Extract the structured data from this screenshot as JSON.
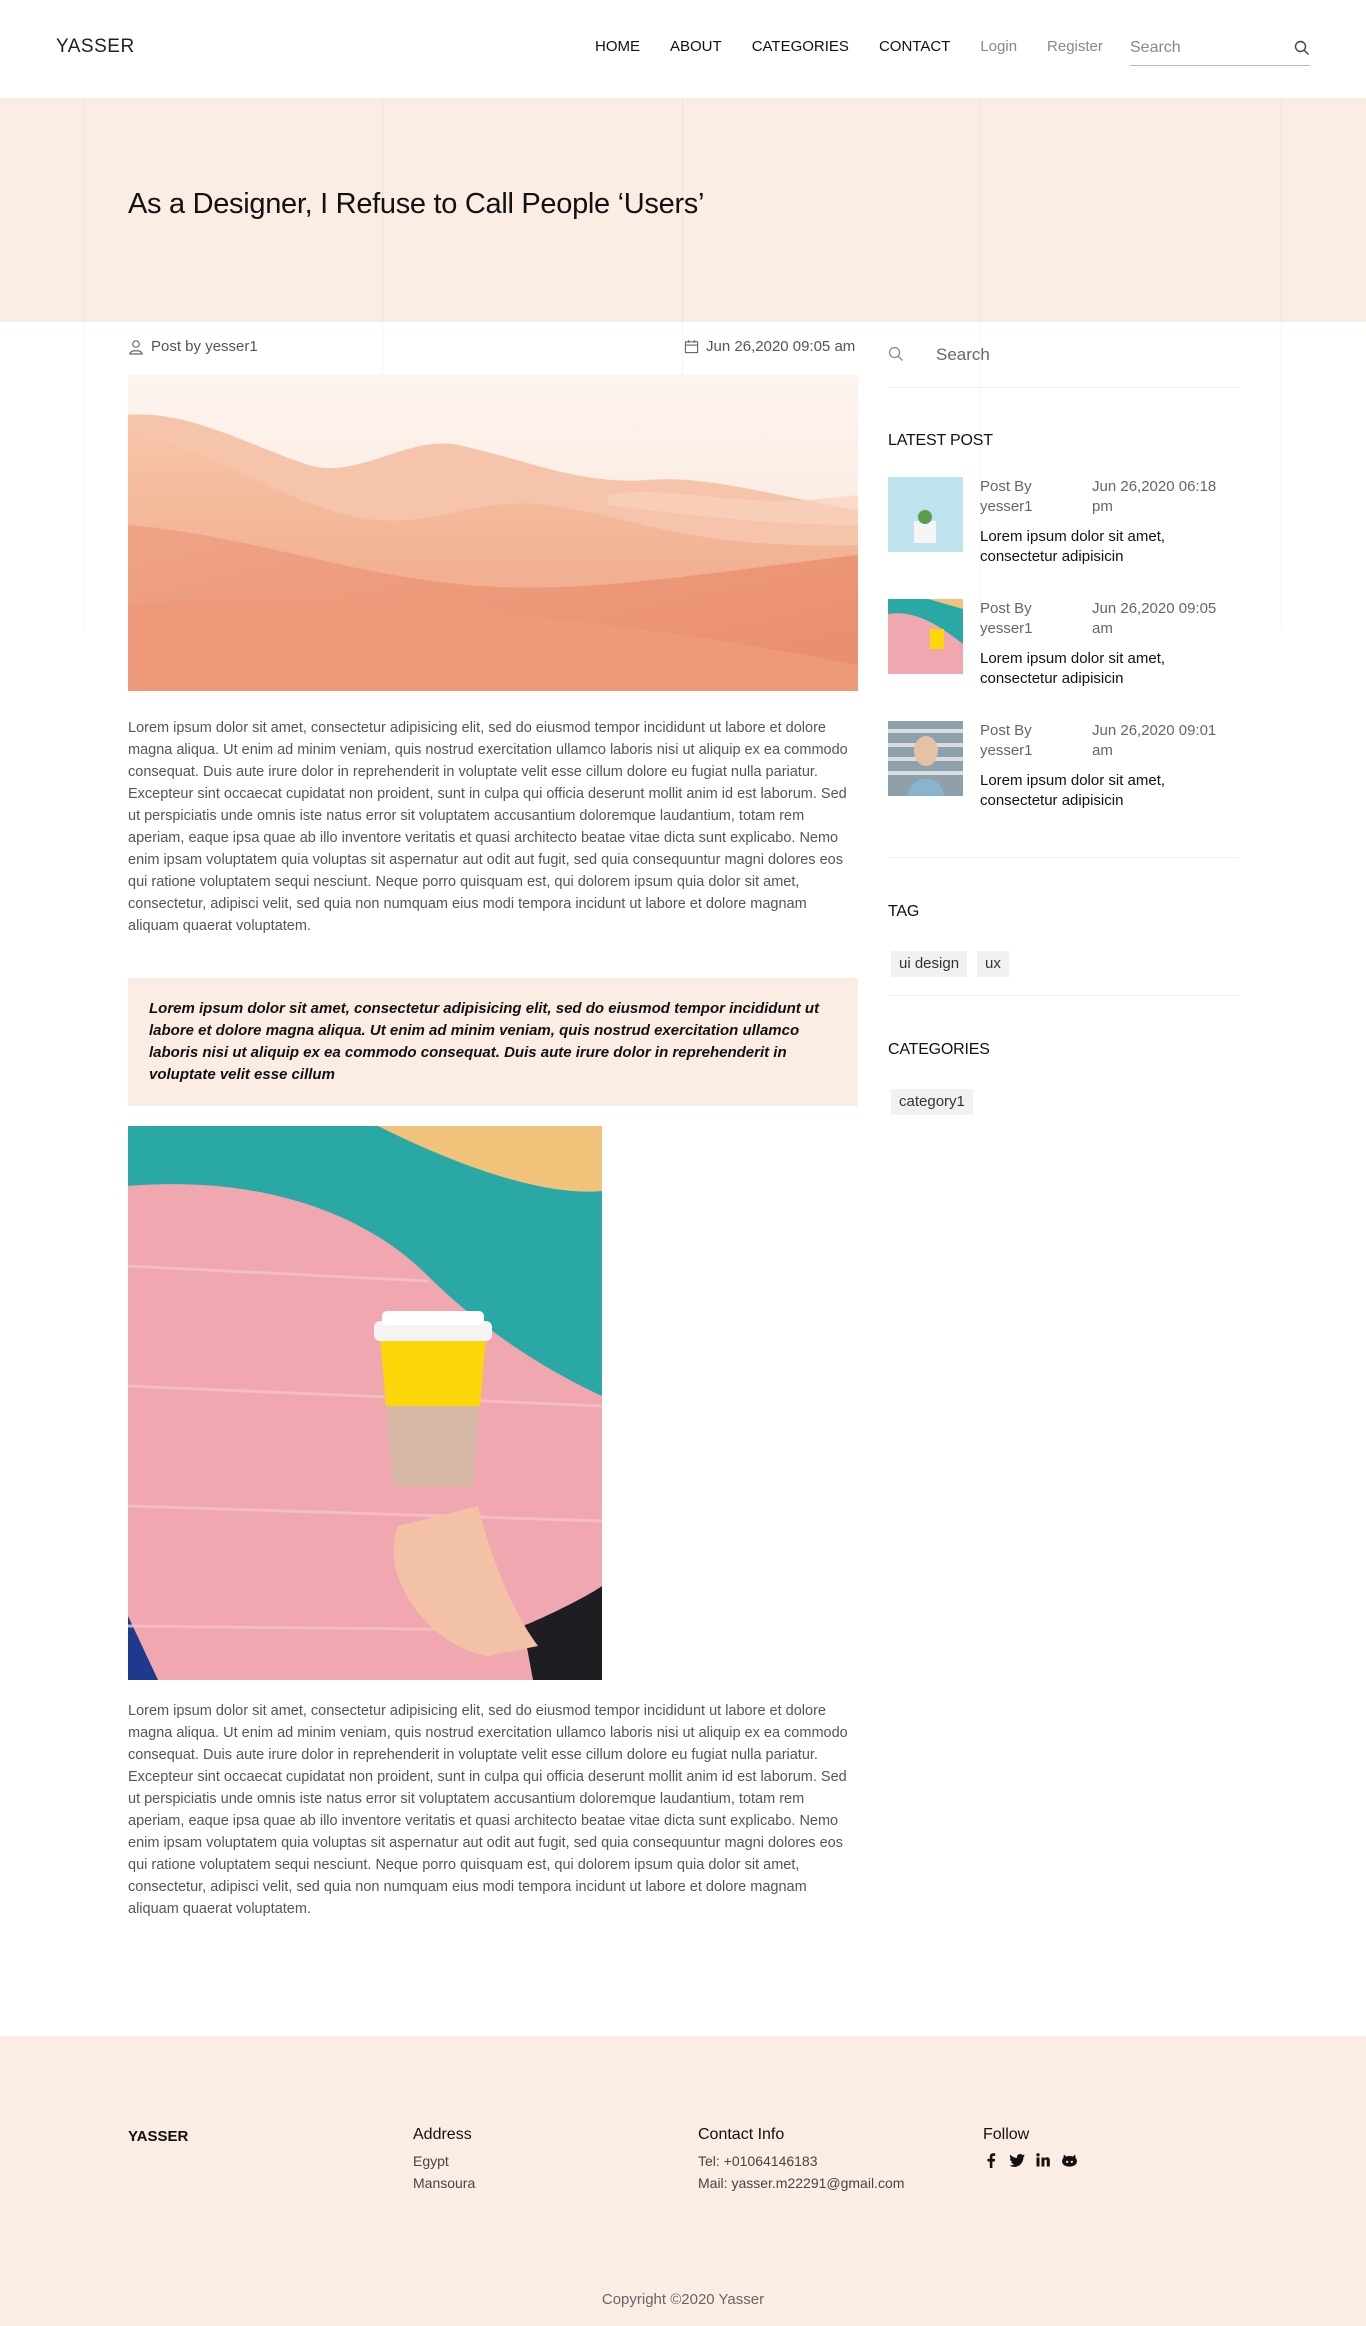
{
  "header": {
    "logo": "YASSER",
    "nav": [
      "HOME",
      "ABOUT",
      "CATEGORIES",
      "CONTACT"
    ],
    "login": "Login",
    "register": "Register",
    "search_placeholder": "Search"
  },
  "hero": {
    "title": "As a Designer, I Refuse to Call People ‘Users’"
  },
  "post": {
    "author": "Post by yesser1",
    "date": "Jun 26,2020 09:05 am",
    "paragraph_1": "Lorem ipsum dolor sit amet, consectetur adipisicing elit, sed do eiusmod tempor incididunt ut labore et dolore magna aliqua. Ut enim ad minim veniam, quis nostrud exercitation ullamco laboris nisi ut aliquip ex ea commodo consequat. Duis aute irure dolor in reprehenderit in voluptate velit esse cillum dolore eu fugiat nulla pariatur. Excepteur sint occaecat cupidatat non proident, sunt in culpa qui officia deserunt mollit anim id est laborum. Sed ut perspiciatis unde omnis iste natus error sit voluptatem accusantium doloremque laudantium, totam rem aperiam, eaque ipsa quae ab illo inventore veritatis et quasi architecto beatae vitae dicta sunt explicabo. Nemo enim ipsam voluptatem quia voluptas sit aspernatur aut odit aut fugit, sed quia consequuntur magni dolores eos qui ratione voluptatem sequi nesciunt. Neque porro quisquam est, qui dolorem ipsum quia dolor sit amet, consectetur, adipisci velit, sed quia non numquam eius modi tempora incidunt ut labore et dolore magnam aliquam quaerat voluptatem.",
    "quote": "Lorem ipsum dolor sit amet, consectetur adipisicing elit, sed do eiusmod tempor incididunt ut labore et dolore magna aliqua. Ut enim ad minim veniam, quis nostrud exercitation ullamco laboris nisi ut aliquip ex ea commodo consequat. Duis aute irure dolor in reprehenderit in voluptate velit esse cillum",
    "paragraph_2": "Lorem ipsum dolor sit amet, consectetur adipisicing elit, sed do eiusmod tempor incididunt ut labore et dolore magna aliqua. Ut enim ad minim veniam, quis nostrud exercitation ullamco laboris nisi ut aliquip ex ea commodo consequat. Duis aute irure dolor in reprehenderit in voluptate velit esse cillum dolore eu fugiat nulla pariatur. Excepteur sint occaecat cupidatat non proident, sunt in culpa qui officia deserunt mollit anim id est laborum. Sed ut perspiciatis unde omnis iste natus error sit voluptatem accusantium doloremque laudantium, totam rem aperiam, eaque ipsa quae ab illo inventore veritatis et quasi architecto beatae vitae dicta sunt explicabo. Nemo enim ipsam voluptatem quia voluptas sit aspernatur aut odit aut fugit, sed quia consequuntur magni dolores eos qui ratione voluptatem sequi nesciunt. Neque porro quisquam est, qui dolorem ipsum quia dolor sit amet, consectetur, adipisci velit, sed quia non numquam eius modi tempora incidunt ut labore et dolore magnam aliquam quaerat voluptatem."
  },
  "sidebar": {
    "search_placeholder": "Search",
    "latest_heading": "LATEST POST",
    "latest_posts": [
      {
        "by": "Post By yesser1",
        "date": "Jun 26,2020 06:18 pm",
        "title": "Lorem ipsum dolor sit amet, consectetur adipisicin"
      },
      {
        "by": "Post By yesser1",
        "date": "Jun 26,2020 09:05 am",
        "title": "Lorem ipsum dolor sit amet, consectetur adipisicin"
      },
      {
        "by": "Post By yesser1",
        "date": "Jun 26,2020 09:01 am",
        "title": "Lorem ipsum dolor sit amet, consectetur adipisicin"
      }
    ],
    "tag_heading": "TAG",
    "tags": [
      "ui design",
      "ux"
    ],
    "categories_heading": "CATEGORIES",
    "categories": [
      "category1"
    ]
  },
  "footer": {
    "brand": "YASSER",
    "address_heading": "Address",
    "address_lines": [
      "Egypt",
      "Mansoura"
    ],
    "contact_heading": "Contact Info",
    "contact_tel": "Tel: +01064146183",
    "contact_mail": "Mail: yasser.m22291@gmail.com",
    "follow_heading": "Follow",
    "socials": [
      "facebook-icon",
      "twitter-icon",
      "linkedin-icon",
      "github-icon"
    ],
    "copyright": "Copyright ©2020 Yasser"
  },
  "colors": {
    "accent_bg": "#fcede4",
    "text_dark": "#111111",
    "text_muted": "#666666"
  }
}
